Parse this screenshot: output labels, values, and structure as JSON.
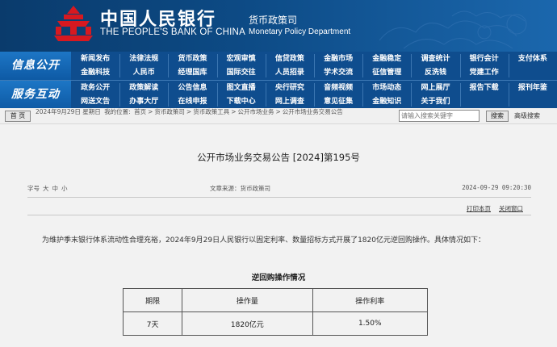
{
  "header": {
    "bank_name_cn": "中国人民银行",
    "bank_name_en": "THE PEOPLE'S BANK OF CHINA",
    "dept_cn": "货币政策司",
    "dept_en": "Monetary Policy Department",
    "brand_color": "#0d4b86",
    "logo_color": "#d71920"
  },
  "nav": {
    "group1": {
      "title": "信息公开",
      "row1": [
        "新闻发布",
        "法律法规",
        "货币政策",
        "宏观审慎",
        "信贷政策",
        "金融市场",
        "金融稳定",
        "调查统计",
        "银行会计",
        "支付体系"
      ],
      "row2": [
        "金融科技",
        "人民币",
        "经理国库",
        "国际交往",
        "人员招录",
        "学术交流",
        "征信管理",
        "反洗钱",
        "党建工作"
      ]
    },
    "group2": {
      "title": "服务互动",
      "row1": [
        "政务公开",
        "政策解读",
        "公告信息",
        "图文直播",
        "央行研究",
        "音频视频",
        "市场动态",
        "网上展厅",
        "报告下载",
        "报刊年鉴"
      ],
      "row2": [
        "网送文告",
        "办事大厅",
        "在线申报",
        "下载中心",
        "网上调查",
        "意见征集",
        "金融知识",
        "关于我们"
      ]
    }
  },
  "toolbar": {
    "home_label": "首 页",
    "date_text": "2024年9月29日 星期日",
    "location_prefix": "我的位置:",
    "crumbs": [
      "首页",
      "货币政策司",
      "货币政策工具",
      "公开市场业务",
      "公开市场业务交易公告"
    ],
    "search_placeholder": "请输入搜索关键字",
    "search_label": "搜索",
    "advanced_label": "高级搜索"
  },
  "article": {
    "title": "公开市场业务交易公告 [2024]第195号",
    "font_size_label": "字号",
    "font_sizes": [
      "大",
      "中",
      "小"
    ],
    "source": "文章来源：货币政策司",
    "datetime": "2024-09-29 09:20:30",
    "print_label": "打印本页",
    "close_label": "关闭窗口",
    "body": "为维护季末银行体系流动性合理充裕，2024年9月29日人民银行以固定利率、数量招标方式开展了1820亿元逆回购操作。具体情况如下：",
    "table_caption": "逆回购操作情况",
    "table": {
      "headers": [
        "期限",
        "操作量",
        "操作利率"
      ],
      "rows": [
        [
          "7天",
          "1820亿元",
          "1.50%"
        ]
      ]
    }
  }
}
